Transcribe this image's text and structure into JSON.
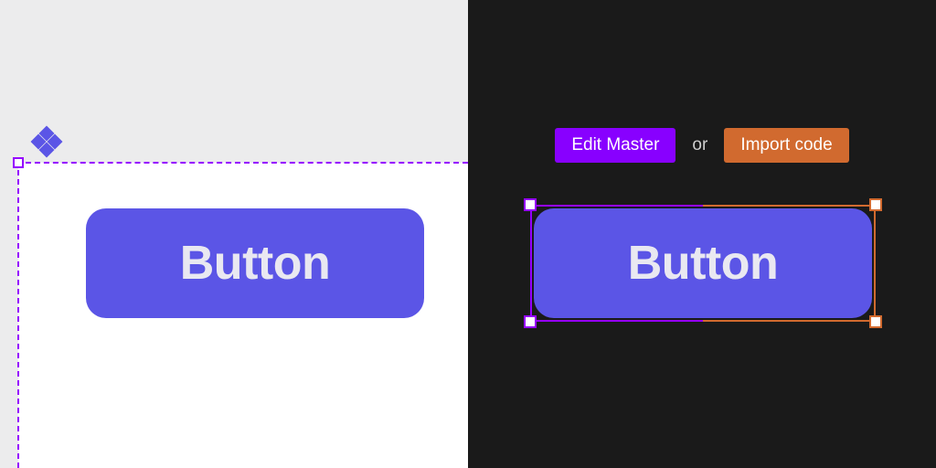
{
  "left": {
    "button_label": "Button"
  },
  "right": {
    "edit_master_label": "Edit Master",
    "or_label": "or",
    "import_code_label": "Import code",
    "button_label": "Button"
  },
  "colors": {
    "button_fill": "#5b55e6",
    "selection_purple": "#9500ff",
    "selection_orange": "#d16a2f",
    "panel_light": "#ececed",
    "panel_dark": "#1a1a1a"
  }
}
